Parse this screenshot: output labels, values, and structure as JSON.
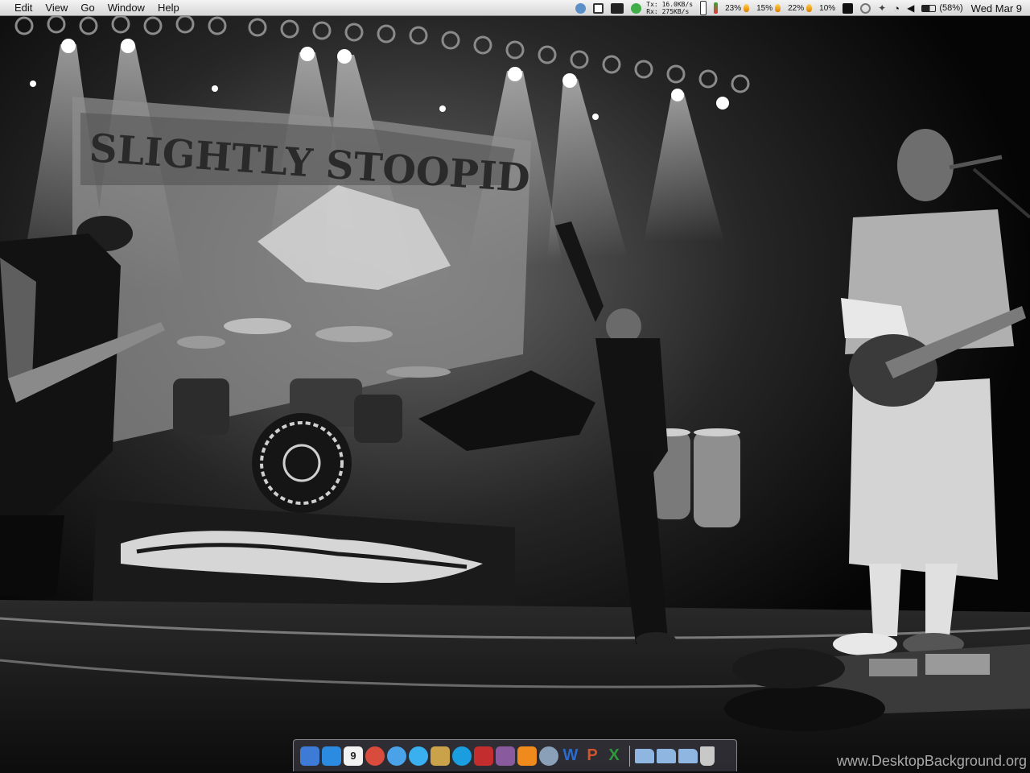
{
  "menubar": {
    "menus": [
      "Edit",
      "View",
      "Go",
      "Window",
      "Help"
    ],
    "network": {
      "tx": "Tx:  16.0KB/s",
      "rx": "Rx:  275KB/s"
    },
    "cpu": [
      "23%",
      "15%",
      "22%",
      "10%"
    ],
    "battery": "(58%)",
    "clock": "Wed Mar 9"
  },
  "wallpaper": {
    "banner_text": "SLIGHTLY STOOPID",
    "watermark": "www.DesktopBackground.org"
  },
  "dock": {
    "calendar_day": "9",
    "apps": [
      {
        "name": "finder-icon",
        "color": "#3d7bd6"
      },
      {
        "name": "app-store-icon",
        "color": "#2a8be0"
      },
      {
        "name": "calendar-icon",
        "color": "#f2f2f2"
      },
      {
        "name": "chrome-icon",
        "color": "#d94b3c"
      },
      {
        "name": "safari-icon",
        "color": "#4aa3e8"
      },
      {
        "name": "messages-icon",
        "color": "#3ab0f0"
      },
      {
        "name": "adium-icon",
        "color": "#c9a24a"
      },
      {
        "name": "skype-icon",
        "color": "#1a9ee0"
      },
      {
        "name": "parallels-icon",
        "color": "#c42d2d"
      },
      {
        "name": "textmate-icon",
        "color": "#8a5a9e"
      },
      {
        "name": "vlc-icon",
        "color": "#f08a1c"
      },
      {
        "name": "picasa-icon",
        "color": "#8aa0b8"
      },
      {
        "name": "word-icon",
        "color": "#2a6bd0"
      },
      {
        "name": "powerpoint-icon",
        "color": "#d2522a"
      },
      {
        "name": "excel-icon",
        "color": "#2e9a3a"
      }
    ],
    "folders": [
      {
        "name": "applications-folder-icon",
        "color": "#8fb6e0"
      },
      {
        "name": "documents-folder-icon",
        "color": "#8fb6e0"
      },
      {
        "name": "downloads-folder-icon",
        "color": "#8fb6e0"
      }
    ],
    "trash": {
      "name": "trash-icon",
      "color": "#c8c8c8"
    },
    "letters": {
      "word": "W",
      "powerpoint": "P",
      "excel": "X"
    }
  }
}
